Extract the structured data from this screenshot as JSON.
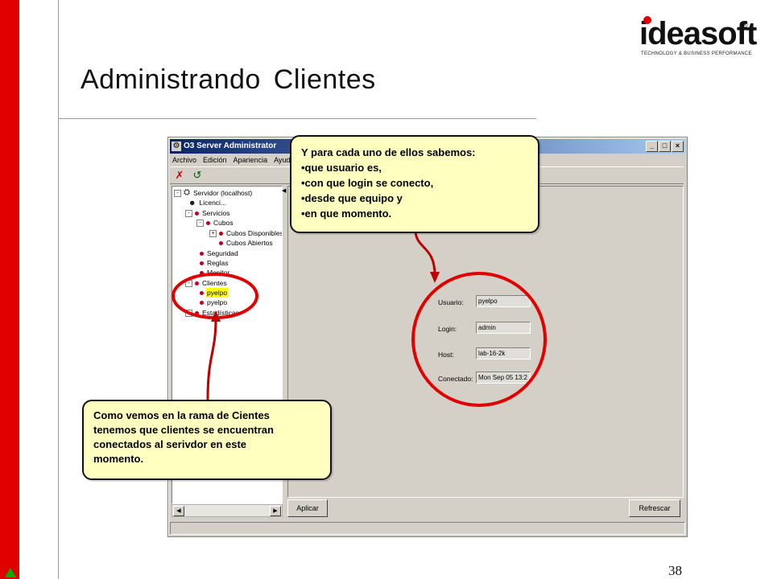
{
  "slide": {
    "title": "Administrando Clientes",
    "page_number": "38",
    "logo": {
      "word": "ideasoft",
      "registered": "®",
      "tagline": "TECHNOLOGY & BUSINESS PERFORMANCE"
    }
  },
  "window": {
    "title": "O3 Server Administrator",
    "controls": {
      "minimize": "_",
      "maximize": "□",
      "close": "×"
    },
    "menu": [
      "Archivo",
      "Edición",
      "Apariencia",
      "Ayud"
    ],
    "toolbar": {
      "disconnect_icon": "disconnect-icon",
      "refresh_icon": "refresh-icon"
    },
    "tree": [
      {
        "label": "Servidor (localhost)",
        "expander": "-"
      },
      {
        "label": "Licenci..."
      },
      {
        "label": "Servicios",
        "expander": "-"
      },
      {
        "label": "Cubos",
        "expander": "-"
      },
      {
        "label": "Cubos Disponibles",
        "expander": "+"
      },
      {
        "label": "Cubos Abiertos"
      },
      {
        "label": "Seguridad"
      },
      {
        "label": "Reglas"
      },
      {
        "label": "Monitor"
      },
      {
        "label": "Clientes",
        "expander": "-"
      },
      {
        "label": "pyelpo",
        "selected": true
      },
      {
        "label": "pyelpo"
      },
      {
        "label": "Estadísticas",
        "expander": "+"
      }
    ],
    "details": {
      "usuario_label": "Usuario:",
      "usuario_value": "pyelpo",
      "login_label": "Login:",
      "login_value": "admin",
      "host_label": "Host:",
      "host_value": "lab-16-2k",
      "conectado_label": "Conectado:",
      "conectado_value": "Mon Sep 05 13:2"
    },
    "buttons": {
      "apply": "Aplicar",
      "refresh": "Refrescar"
    }
  },
  "callout_top": {
    "lines": [
      "Y para cada uno de ellos sabemos:",
      "•que usuario es,",
      "•con que login se conecto,",
      "•desde que equipo y",
      "•en que momento."
    ]
  },
  "callout_bottom": {
    "lines": [
      "Como vemos en la rama de Cientes",
      "tenemos que clientes se encuentran",
      "conectados al serivdor en este",
      "momento."
    ]
  },
  "colors": {
    "accent_red": "#e00000",
    "callout_fill": "#ffffc0",
    "highlight": "#ffff00"
  }
}
